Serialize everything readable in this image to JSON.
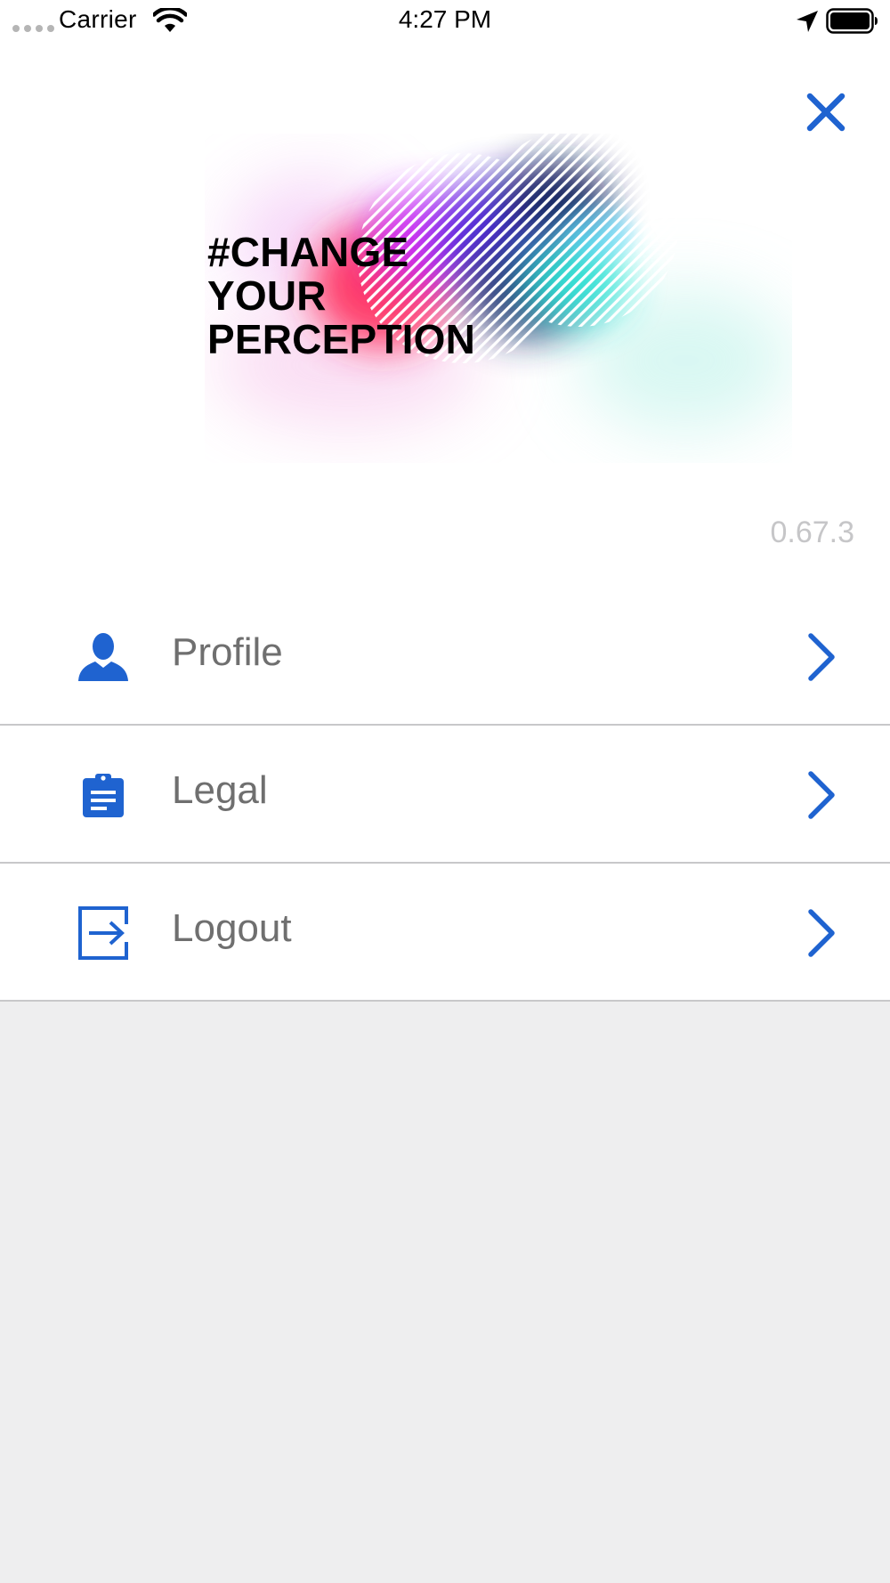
{
  "status_bar": {
    "carrier": "Carrier",
    "time": "4:27 PM",
    "icons": [
      "signal-dots",
      "wifi-icon",
      "location-arrow-icon",
      "battery-icon"
    ]
  },
  "header": {
    "close_icon": "close-icon",
    "hero_text": "#CHANGE\nYOUR\nPERCEPTION"
  },
  "version": "0.67.3",
  "menu": {
    "items": [
      {
        "label": "Profile",
        "icon": "person-icon"
      },
      {
        "label": "Legal",
        "icon": "clipboard-icon"
      },
      {
        "label": "Logout",
        "icon": "logout-icon"
      }
    ]
  },
  "colors": {
    "accent": "#1f63d0",
    "label": "#6f6f6f",
    "version": "#c6c6c8",
    "background": "#eeeeef",
    "divider": "#c8c8ca"
  }
}
